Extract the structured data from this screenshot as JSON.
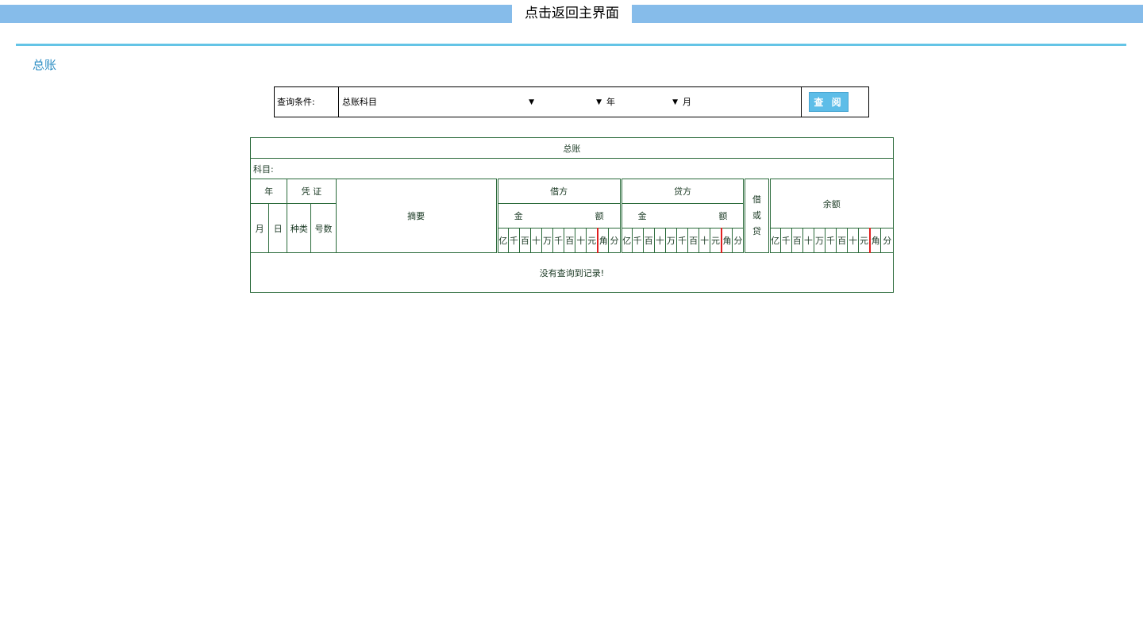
{
  "header": {
    "home_link": "点击返回主界面"
  },
  "page": {
    "title": "总账"
  },
  "query": {
    "label": "查询条件:",
    "account_select": "总账科目",
    "year_suffix": "年",
    "month_suffix": "月",
    "submit_label": "查 阅",
    "arrow": "▼"
  },
  "ledger": {
    "title": "总账",
    "account_label": "科目:",
    "col_year": "年",
    "col_voucher": "凭 证",
    "col_month": "月",
    "col_day": "日",
    "col_type": "种类",
    "col_number": "号数",
    "col_summary": "摘要",
    "col_debit": "借方",
    "col_credit": "贷方",
    "col_dc": "借\n或\n贷",
    "col_balance": "余额",
    "amount_left": "金",
    "amount_right": "额",
    "digits": [
      "亿",
      "千",
      "百",
      "十",
      "万",
      "千",
      "百",
      "十",
      "元",
      "角",
      "分"
    ],
    "empty_message": "没有查询到记录!"
  },
  "colors": {
    "topbar": "#86bcea",
    "rule": "#64c4e6",
    "title": "#2f8fc4",
    "button": "#5dbde8",
    "grid": "#2a6a3a",
    "yuan_divider": "#e02020"
  }
}
